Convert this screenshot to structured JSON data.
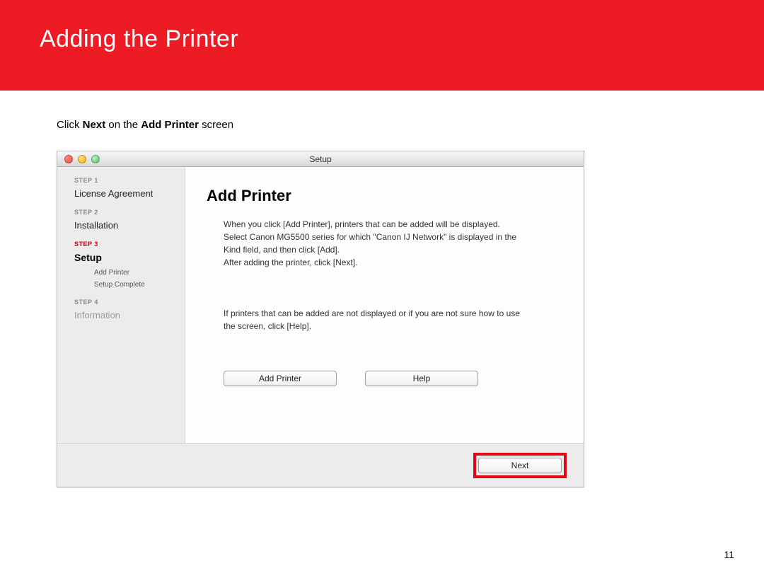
{
  "header": {
    "title": "Adding  the Printer"
  },
  "instruction": {
    "prefix": "Click ",
    "bold1": "Next",
    "mid": " on the ",
    "bold2": "Add Printer",
    "suffix": " screen"
  },
  "window": {
    "title": "Setup",
    "sidebar": {
      "step1_label": "STEP 1",
      "step1_name": "License Agreement",
      "step2_label": "STEP 2",
      "step2_name": "Installation",
      "step3_label": "STEP 3",
      "step3_name": "Setup",
      "substep1": "Add Printer",
      "substep2": "Setup Complete",
      "step4_label": "STEP 4",
      "step4_name": "Information"
    },
    "main": {
      "heading": "Add Printer",
      "body1": "When you click [Add Printer], printers that can be added will be displayed. Select Canon MG5500 series for which \"Canon IJ Network\" is displayed in the Kind field, and then click [Add].\nAfter adding the printer, click [Next].",
      "body2": "If printers that can be added are not displayed or if you are not sure how to use the screen, click [Help].",
      "add_printer_btn": "Add Printer",
      "help_btn": "Help",
      "next_btn": "Next"
    }
  },
  "page_number": "11"
}
